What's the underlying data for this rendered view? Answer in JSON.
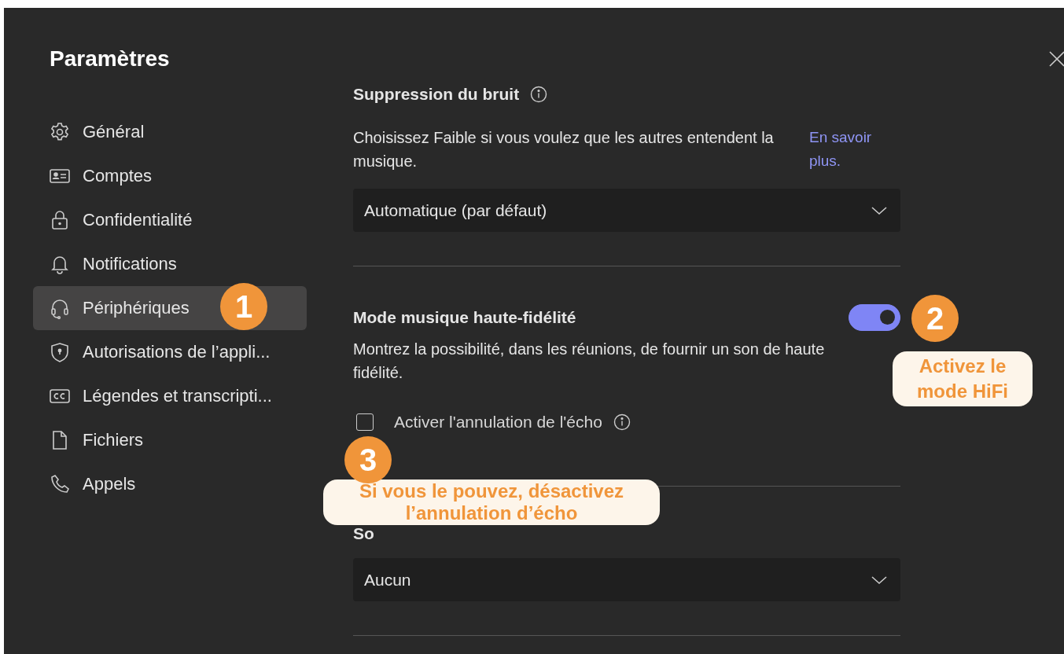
{
  "window": {
    "title": "Paramètres"
  },
  "sidebar": {
    "items": [
      {
        "label": "Général",
        "selected": false
      },
      {
        "label": "Comptes",
        "selected": false
      },
      {
        "label": "Confidentialité",
        "selected": false
      },
      {
        "label": "Notifications",
        "selected": false
      },
      {
        "label": "Périphériques",
        "selected": true
      },
      {
        "label": "Autorisations de l’appli...",
        "selected": false
      },
      {
        "label": "Légendes et transcripti...",
        "selected": false
      },
      {
        "label": "Fichiers",
        "selected": false
      },
      {
        "label": "Appels",
        "selected": false
      }
    ]
  },
  "noise_suppression": {
    "heading": "Suppression du bruit",
    "description": "Choisissez Faible si vous voulez que les autres entendent la musique.",
    "link": "En savoir plus.",
    "dropdown": {
      "value": "Automatique (par défaut)"
    }
  },
  "hifi_music_mode": {
    "heading": "Mode musique haute-fidélité",
    "on": true,
    "description": "Montrez la possibilité, dans les réunions, de fournir un son de haute fidélité.",
    "echo_cancellation": {
      "label": "Activer l'annulation de l'écho",
      "checked": false
    }
  },
  "secondary_ringer": {
    "heading": "So",
    "dropdown": {
      "value": "Aucun"
    }
  },
  "annotations": [
    {
      "number": "1"
    },
    {
      "number": "2",
      "text": "Activez le mode HiFi"
    },
    {
      "number": "3",
      "text": "Si vous le pouvez, désactivez l’annulation d’écho"
    }
  ]
}
